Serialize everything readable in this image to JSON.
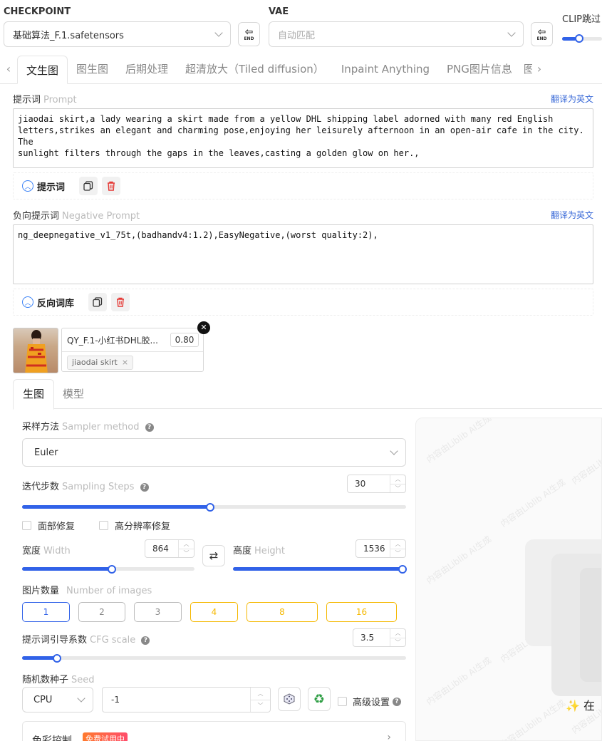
{
  "checkpoint": {
    "label": "CHECKPOINT",
    "value": "基础算法_F.1.safetensors"
  },
  "vae": {
    "label": "VAE",
    "value": "自动匹配"
  },
  "clip": {
    "label": "CLIP跳过",
    "value": 0.05
  },
  "end_label": "END",
  "tabs": [
    "文生图",
    "图生图",
    "后期处理",
    "超清放大（Tiled diffusion）",
    "Inpaint Anything",
    "PNG图片信息",
    "图"
  ],
  "prompt": {
    "label": "提示词",
    "label_en": "Prompt",
    "translate": "翻译为英文",
    "text": "jiaodai skirt,a lady wearing a skirt made from a yellow DHL shipping label adorned with many red English\nletters,strikes an elegant and charming pose,enjoying her leisurely afternoon in an open-air cafe in the city. The\nsunlight filters through the gaps in the leaves,casting a golden glow on her.,",
    "library_label": "提示词"
  },
  "negative": {
    "label": "负向提示词",
    "label_en": "Negative Prompt",
    "translate": "翻译为英文",
    "text": "ng_deepnegative_v1_75t,(badhandv4:1.2),EasyNegative,(worst quality:2),",
    "library_label": "反向词库"
  },
  "lora": {
    "name": "QY_F.1-小红书DHL胶...",
    "weight": "0.80",
    "trigger": "jiaodai skirt"
  },
  "subtabs": [
    "生图",
    "模型"
  ],
  "sampler": {
    "label": "采样方法",
    "label_en": "Sampler method",
    "value": "Euler"
  },
  "steps": {
    "label": "迭代步数",
    "label_en": "Sampling Steps",
    "value": "30",
    "fraction": 0.49
  },
  "face_fix": "面部修复",
  "hires_fix": "高分辨率修复",
  "width": {
    "label": "宽度",
    "label_en": "Width",
    "value": "864",
    "fraction": 0.52
  },
  "height": {
    "label": "高度",
    "label_en": "Height",
    "value": "1536",
    "fraction": 1.0
  },
  "images": {
    "label": "图片数量",
    "label_en": "Number of images",
    "options": [
      "1",
      "2",
      "3",
      "4",
      "8",
      "16"
    ],
    "selected": "1"
  },
  "cfg": {
    "label": "提示词引导系数",
    "label_en": "CFG scale",
    "value": "3.5",
    "fraction": 0.09
  },
  "seed": {
    "label": "随机数种子",
    "label_en": "Seed",
    "device": "CPU",
    "value": "-1",
    "advanced": "高级设置"
  },
  "color_control": {
    "label": "色彩控制",
    "badge": "免费试用中"
  },
  "watermark": "内容由Liblib AI生成",
  "preview_text": "在",
  "colors": {
    "accent": "#3162e8",
    "warn": "#f5b800",
    "danger": "#e53935"
  }
}
